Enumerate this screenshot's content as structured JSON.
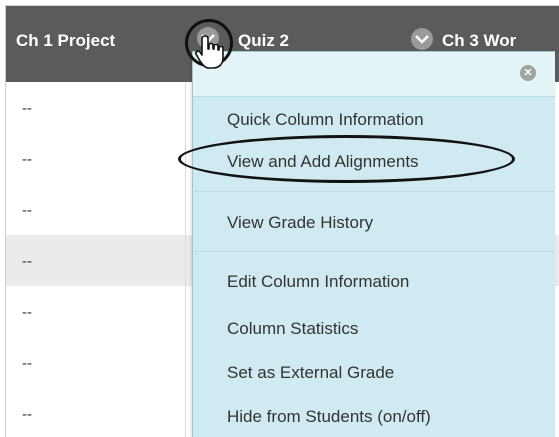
{
  "columns": [
    {
      "title": "Ch 1 Project"
    },
    {
      "title": "Quiz 2"
    },
    {
      "title": "Ch 3 Wor"
    }
  ],
  "rows": [
    "--",
    "--",
    "--",
    "--",
    "--",
    "--",
    "--"
  ],
  "menu": {
    "items": [
      {
        "label": "Quick Column Information"
      },
      {
        "label": "View and Add Alignments"
      },
      {
        "label": "View Grade History"
      },
      {
        "label": "Edit Column Information"
      },
      {
        "label": "Column Statistics"
      },
      {
        "label": "Set as External Grade"
      },
      {
        "label": "Hide from Students (on/off)"
      }
    ],
    "close_icon": "close-icon"
  },
  "colors": {
    "header_bg": "#5b5b5b",
    "menu_bg": "#cfeaf0",
    "highlight_stroke": "#111111"
  }
}
